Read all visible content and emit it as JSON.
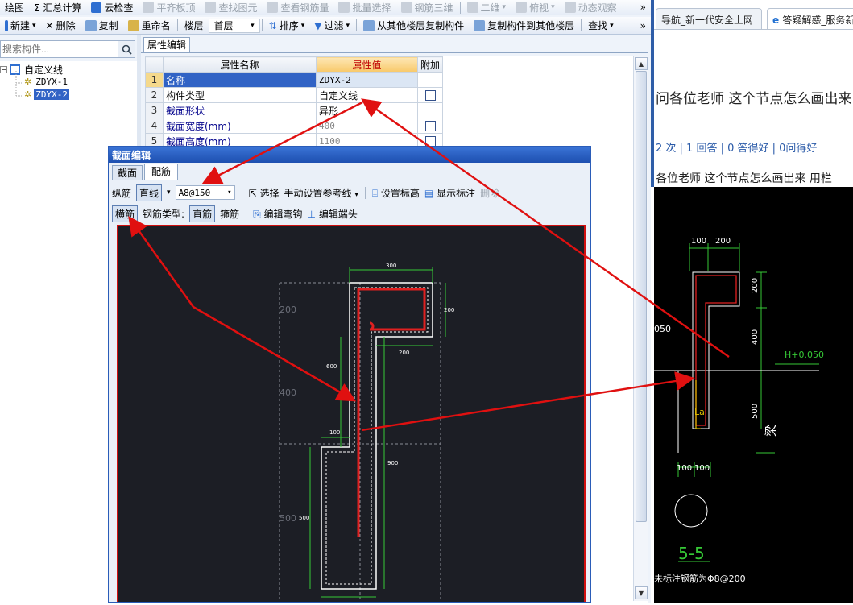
{
  "toolbar1": {
    "items": [
      {
        "label": "绘图",
        "icon": "draw-icon",
        "disabled": false
      },
      {
        "label": "Σ 汇总计算",
        "icon": "sum-icon",
        "disabled": false
      },
      {
        "label": "云检查",
        "icon": "cloud-check-icon",
        "disabled": false
      },
      {
        "label": "平齐板顶",
        "icon": "align-slab-icon",
        "disabled": true
      },
      {
        "label": "查找图元",
        "icon": "find-element-icon",
        "disabled": true
      },
      {
        "label": "查看钢筋量",
        "icon": "rebar-qty-icon",
        "disabled": true
      },
      {
        "label": "批量选择",
        "icon": "batch-select-icon",
        "disabled": true
      },
      {
        "label": "钢筋三维",
        "icon": "rebar-3d-icon",
        "disabled": true
      },
      {
        "label": "二维",
        "icon": "2d-icon",
        "disabled": true
      },
      {
        "label": "俯视",
        "icon": "topview-icon",
        "disabled": true
      },
      {
        "label": "动态观察",
        "icon": "orbit-icon",
        "disabled": true
      }
    ],
    "overflow": "»"
  },
  "toolbar2": {
    "new_label": "新建",
    "delete_label": "删除",
    "copy_label": "复制",
    "rename_label": "重命名",
    "floor_label": "楼层",
    "floor_value": "首层",
    "sort_label": "排序",
    "filter_label": "过滤",
    "copy_from_label": "从其他楼层复制构件",
    "copy_to_label": "复制构件到其他楼层",
    "find_label": "查找",
    "overflow": "»"
  },
  "search": {
    "placeholder": "搜索构件..."
  },
  "tree": {
    "root": "自定义线",
    "children": [
      "ZDYX-1",
      "ZDYX-2"
    ],
    "selected": "ZDYX-2"
  },
  "props": {
    "tab_label": "属性编辑",
    "headers": {
      "name": "属性名称",
      "value": "属性值",
      "extra": "附加"
    },
    "rows": [
      {
        "num": "1",
        "name": "名称",
        "value": "ZDYX-2",
        "check": false
      },
      {
        "num": "2",
        "name": "构件类型",
        "value": "自定义线",
        "check": true
      },
      {
        "num": "3",
        "name": "截面形状",
        "value": "异形",
        "check": false
      },
      {
        "num": "4",
        "name": "截面宽度(mm)",
        "value": "400",
        "check": true
      },
      {
        "num": "5",
        "name": "截面高度(mm)",
        "value": "1100",
        "check": true
      }
    ]
  },
  "dialog": {
    "title": "截面编辑",
    "tabs": [
      "截面",
      "配筋"
    ],
    "active_tab": "配筋",
    "row1": {
      "zongjin": "纵筋",
      "zhixian": "直线",
      "spec": "A8@150",
      "select": "选择",
      "manual_ref": "手动设置参考线",
      "set_elev": "设置标高",
      "show_mark": "显示标注",
      "delete": "删除"
    },
    "row2": {
      "hengjin": "横筋",
      "type_label": "钢筋类型:",
      "zhijin": "直筋",
      "gujin": "箍筋",
      "edit_hook": "编辑弯钩",
      "edit_end": "编辑端头"
    },
    "canvas": {
      "dims": [
        "300",
        "200",
        "200",
        "600",
        "100",
        "900",
        "500",
        "200"
      ],
      "grid_labels": [
        "200",
        "400",
        "500"
      ]
    }
  },
  "browser": {
    "tabs": [
      "导航_新一代安全上网",
      "答疑解惑_服务新"
    ],
    "question_title": "问各位老师 这个节点怎么画出来",
    "meta": "2 次 | 1 回答 | 0 答得好 | 0问得好",
    "body_line": "各位老师 这个节点怎么画出来  用栏"
  },
  "cad": {
    "dims": [
      "100",
      "200",
      "200",
      "400",
      "500",
      "100",
      "100"
    ],
    "elevation": "H+0.050",
    "elev_left": "050",
    "beam": "梁",
    "la": "La",
    "section": "5-5",
    "note": "未标注钢筋为Φ8@200"
  },
  "colors": {
    "arrow": "#e01010",
    "rebar": "#e02020",
    "dim": "#36c936",
    "outline": "#ffffff"
  }
}
